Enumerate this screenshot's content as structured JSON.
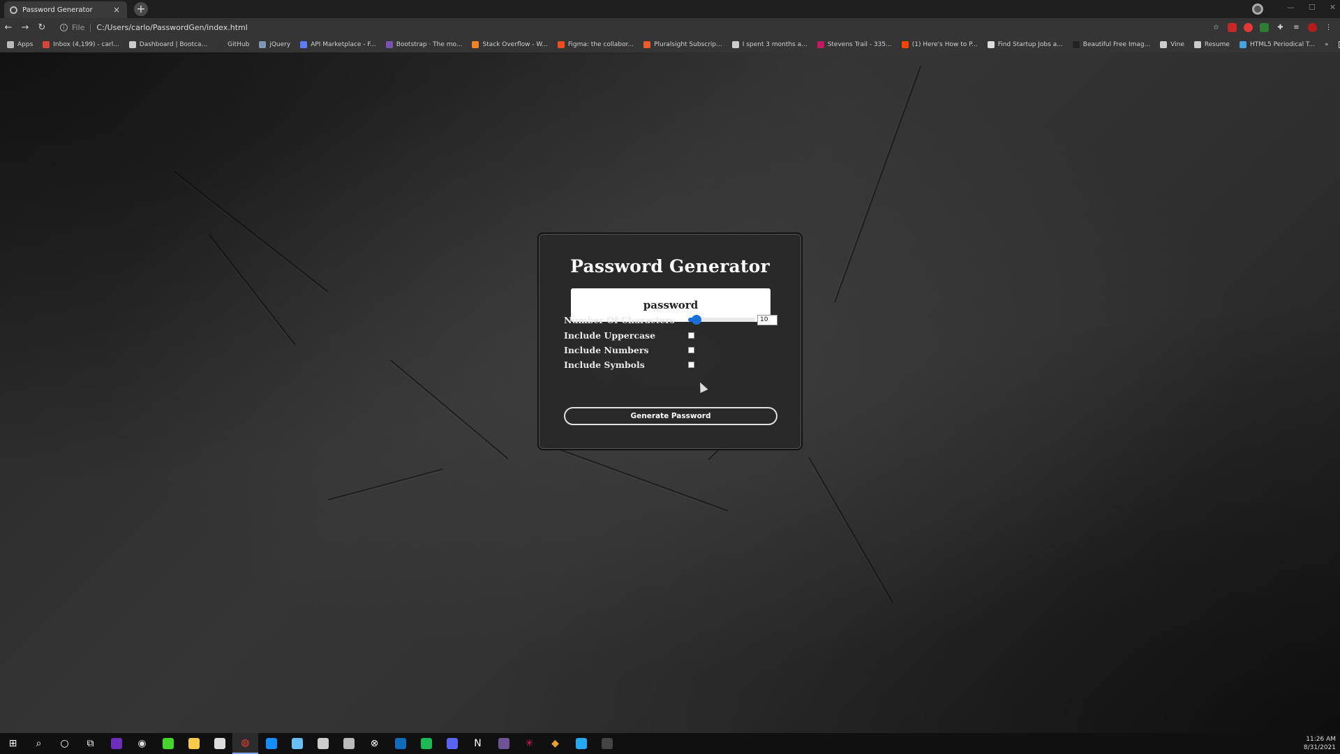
{
  "browser": {
    "tab_title": "Password Generator",
    "tab_close": "×",
    "new_tab": "+",
    "url_scheme": "File",
    "url": "C:/Users/carlo/PasswordGen/index.html"
  },
  "bookmarks": [
    {
      "label": "Apps",
      "icon": "apps-grid-icon",
      "color": "#bbbbbb"
    },
    {
      "label": "Inbox (4,199) - carl...",
      "icon": "gmail-icon",
      "color": "#d44638"
    },
    {
      "label": "Dashboard | Bootca...",
      "icon": "globe-icon",
      "color": "#cccccc"
    },
    {
      "label": "GitHub",
      "icon": "github-icon",
      "color": "#333333"
    },
    {
      "label": "jQuery",
      "icon": "jquery-icon",
      "color": "#7e97b3"
    },
    {
      "label": "API Marketplace - F...",
      "icon": "rapidapi-icon",
      "color": "#5c7cfa"
    },
    {
      "label": "Bootstrap · The mo...",
      "icon": "bootstrap-icon",
      "color": "#7952b3"
    },
    {
      "label": "Stack Overflow - W...",
      "icon": "stackoverflow-icon",
      "color": "#f48024"
    },
    {
      "label": "Figma: the collabor...",
      "icon": "figma-icon",
      "color": "#f24e1e"
    },
    {
      "label": "Pluralsight Subscrip...",
      "icon": "pluralsight-icon",
      "color": "#f15b2a"
    },
    {
      "label": "I spent 3 months a...",
      "icon": "medium-icon",
      "color": "#cccccc"
    },
    {
      "label": "Stevens Trail - 335...",
      "icon": "alltrails-icon",
      "color": "#c2185b"
    },
    {
      "label": "(1) Here's How to P...",
      "icon": "reddit-icon",
      "color": "#ff4500"
    },
    {
      "label": "Find Startup Jobs a...",
      "icon": "angellist-icon",
      "color": "#dddddd"
    },
    {
      "label": "Beautiful Free Imag...",
      "icon": "unsplash-icon",
      "color": "#222222"
    },
    {
      "label": "Vine",
      "icon": "globe-icon",
      "color": "#cccccc"
    },
    {
      "label": "Resume",
      "icon": "globe-icon",
      "color": "#cccccc"
    },
    {
      "label": "HTML5 Periodical T...",
      "icon": "html5-icon",
      "color": "#4aa3df"
    }
  ],
  "bookmarks_more": "»",
  "reading_list": "Reading list",
  "app": {
    "title": "Password Generator",
    "password": "password",
    "length_label": "Number Of Characters",
    "length_value": "10",
    "slider": {
      "min": 8,
      "max": 128,
      "value": 10
    },
    "uppercase_label": "Include Uppercase",
    "numbers_label": "Include Numbers",
    "symbols_label": "Include Symbols",
    "generate_label": "Generate Password",
    "accent_color": "#1a6fd8"
  },
  "taskbar": {
    "time": "11:26 AM",
    "date": "8/31/2021",
    "apps": [
      {
        "name": "windows-start-icon",
        "glyph": "⊞",
        "color": "#ffffff"
      },
      {
        "name": "search-icon",
        "glyph": "⌕",
        "color": "#ffffff"
      },
      {
        "name": "cortana-icon",
        "glyph": "○",
        "color": "#ffffff"
      },
      {
        "name": "task-view-icon",
        "glyph": "⧉",
        "color": "#ffffff"
      },
      {
        "name": "nzxt-icon",
        "glyph": "",
        "color": "#6f2dbd"
      },
      {
        "name": "obs-icon",
        "glyph": "◉",
        "color": "#dddddd"
      },
      {
        "name": "razer-icon",
        "glyph": "",
        "color": "#44d62c"
      },
      {
        "name": "file-explorer-icon",
        "glyph": "",
        "color": "#f8c94a"
      },
      {
        "name": "store-icon",
        "glyph": "",
        "color": "#dddddd"
      },
      {
        "name": "chrome-icon",
        "glyph": "◍",
        "color": "#e94235"
      },
      {
        "name": "battlenet-icon",
        "glyph": "",
        "color": "#148eff"
      },
      {
        "name": "steam-icon",
        "glyph": "",
        "color": "#66c0f4"
      },
      {
        "name": "origin-icon",
        "glyph": "",
        "color": "#cccccc"
      },
      {
        "name": "epic-games-icon",
        "glyph": "",
        "color": "#bbbbbb"
      },
      {
        "name": "xbox-icon",
        "glyph": "⊗",
        "color": "#ffffff"
      },
      {
        "name": "outlook-icon",
        "glyph": "",
        "color": "#0f6cbd"
      },
      {
        "name": "spotify-icon",
        "glyph": "",
        "color": "#1db954"
      },
      {
        "name": "discord-icon",
        "glyph": "",
        "color": "#5865f2"
      },
      {
        "name": "notion-icon",
        "glyph": "N",
        "color": "#ffffff"
      },
      {
        "name": "mongodb-compass-icon",
        "glyph": "",
        "color": "#6e5494"
      },
      {
        "name": "slack-icon",
        "glyph": "✳",
        "color": "#e01e5a"
      },
      {
        "name": "git-kraken-icon",
        "glyph": "◆",
        "color": "#f0a030"
      },
      {
        "name": "vscode-icon",
        "glyph": "",
        "color": "#23a9f2"
      },
      {
        "name": "terminal-icon",
        "glyph": "",
        "color": "#444444"
      }
    ]
  }
}
